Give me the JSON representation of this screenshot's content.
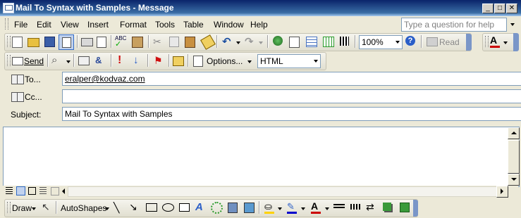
{
  "window": {
    "title": "Mail To Syntax with Samples - Message"
  },
  "menu": {
    "items": [
      "File",
      "Edit",
      "View",
      "Insert",
      "Format",
      "Tools",
      "Table",
      "Window",
      "Help"
    ],
    "ask_placeholder": "Type a question for help"
  },
  "standard_toolbar": {
    "zoom": "100%",
    "read_label": "Read"
  },
  "message_toolbar": {
    "send_label": "Send",
    "options_label": "Options...",
    "format_value": "HTML"
  },
  "fields": {
    "to_label": "To...",
    "cc_label": "Cc...",
    "subject_label": "Subject:",
    "to_value": "eralper@kodvaz.com",
    "cc_value": "",
    "subject_value": "Mail To Syntax with Samples"
  },
  "drawing_toolbar": {
    "draw_label": "Draw",
    "autoshapes_label": "AutoShapes"
  },
  "colors": {
    "titlebar": "#0a246a",
    "accent_red": "#cc0000",
    "fill_yellow": "#ffd200",
    "link_blue": "#0000cc"
  }
}
